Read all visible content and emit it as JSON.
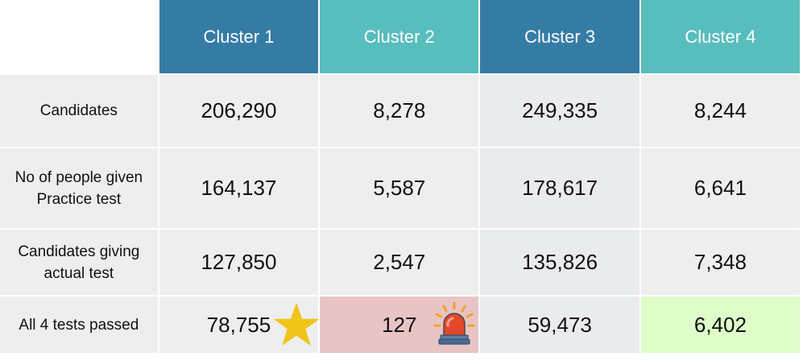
{
  "columns": [
    "Cluster 1",
    "Cluster 2",
    "Cluster 3",
    "Cluster 4"
  ],
  "column_colors": [
    "#357ca5",
    "#58bdbd",
    "#357ca5",
    "#58bdbd"
  ],
  "rows": [
    {
      "label": "Candidates",
      "values": [
        "206,290",
        "8,278",
        "249,335",
        "8,244"
      ]
    },
    {
      "label": "No of people given Practice test",
      "values": [
        "164,137",
        "5,587",
        "178,617",
        "6,641"
      ]
    },
    {
      "label": "Candidates giving actual test",
      "values": [
        "127,850",
        "2,547",
        "135,826",
        "7,348"
      ]
    },
    {
      "label": "All 4 tests passed",
      "values": [
        "78,755",
        "127",
        "59,473",
        "6,402"
      ]
    }
  ],
  "highlights": {
    "cluster1_passed_icon": "star-icon",
    "cluster2_passed_icon": "siren-icon",
    "cluster2_passed_color": "#e8c4c5",
    "cluster4_passed_color": "#defdc9"
  }
}
